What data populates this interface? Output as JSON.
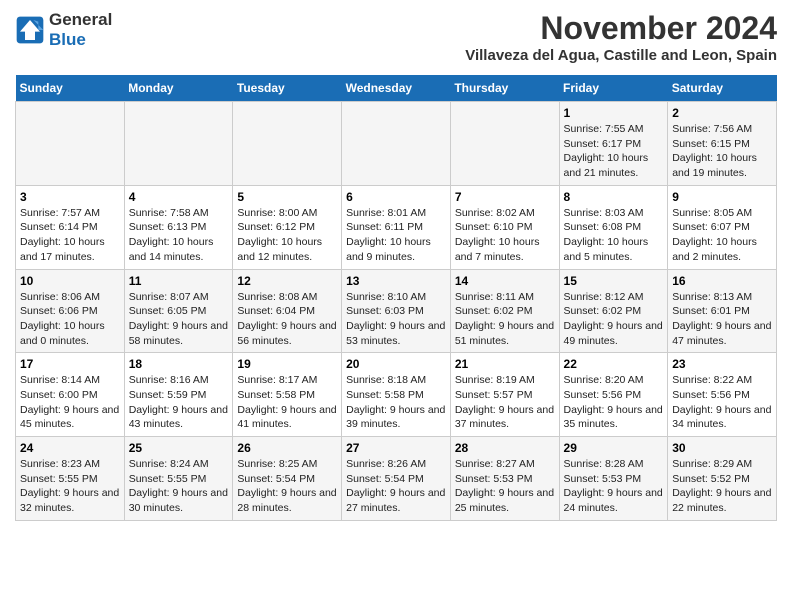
{
  "header": {
    "logo_line1": "General",
    "logo_line2": "Blue",
    "month": "November 2024",
    "location": "Villaveza del Agua, Castille and Leon, Spain"
  },
  "days_of_week": [
    "Sunday",
    "Monday",
    "Tuesday",
    "Wednesday",
    "Thursday",
    "Friday",
    "Saturday"
  ],
  "weeks": [
    [
      {
        "day": "",
        "info": ""
      },
      {
        "day": "",
        "info": ""
      },
      {
        "day": "",
        "info": ""
      },
      {
        "day": "",
        "info": ""
      },
      {
        "day": "",
        "info": ""
      },
      {
        "day": "1",
        "info": "Sunrise: 7:55 AM\nSunset: 6:17 PM\nDaylight: 10 hours and 21 minutes."
      },
      {
        "day": "2",
        "info": "Sunrise: 7:56 AM\nSunset: 6:15 PM\nDaylight: 10 hours and 19 minutes."
      }
    ],
    [
      {
        "day": "3",
        "info": "Sunrise: 7:57 AM\nSunset: 6:14 PM\nDaylight: 10 hours and 17 minutes."
      },
      {
        "day": "4",
        "info": "Sunrise: 7:58 AM\nSunset: 6:13 PM\nDaylight: 10 hours and 14 minutes."
      },
      {
        "day": "5",
        "info": "Sunrise: 8:00 AM\nSunset: 6:12 PM\nDaylight: 10 hours and 12 minutes."
      },
      {
        "day": "6",
        "info": "Sunrise: 8:01 AM\nSunset: 6:11 PM\nDaylight: 10 hours and 9 minutes."
      },
      {
        "day": "7",
        "info": "Sunrise: 8:02 AM\nSunset: 6:10 PM\nDaylight: 10 hours and 7 minutes."
      },
      {
        "day": "8",
        "info": "Sunrise: 8:03 AM\nSunset: 6:08 PM\nDaylight: 10 hours and 5 minutes."
      },
      {
        "day": "9",
        "info": "Sunrise: 8:05 AM\nSunset: 6:07 PM\nDaylight: 10 hours and 2 minutes."
      }
    ],
    [
      {
        "day": "10",
        "info": "Sunrise: 8:06 AM\nSunset: 6:06 PM\nDaylight: 10 hours and 0 minutes."
      },
      {
        "day": "11",
        "info": "Sunrise: 8:07 AM\nSunset: 6:05 PM\nDaylight: 9 hours and 58 minutes."
      },
      {
        "day": "12",
        "info": "Sunrise: 8:08 AM\nSunset: 6:04 PM\nDaylight: 9 hours and 56 minutes."
      },
      {
        "day": "13",
        "info": "Sunrise: 8:10 AM\nSunset: 6:03 PM\nDaylight: 9 hours and 53 minutes."
      },
      {
        "day": "14",
        "info": "Sunrise: 8:11 AM\nSunset: 6:02 PM\nDaylight: 9 hours and 51 minutes."
      },
      {
        "day": "15",
        "info": "Sunrise: 8:12 AM\nSunset: 6:02 PM\nDaylight: 9 hours and 49 minutes."
      },
      {
        "day": "16",
        "info": "Sunrise: 8:13 AM\nSunset: 6:01 PM\nDaylight: 9 hours and 47 minutes."
      }
    ],
    [
      {
        "day": "17",
        "info": "Sunrise: 8:14 AM\nSunset: 6:00 PM\nDaylight: 9 hours and 45 minutes."
      },
      {
        "day": "18",
        "info": "Sunrise: 8:16 AM\nSunset: 5:59 PM\nDaylight: 9 hours and 43 minutes."
      },
      {
        "day": "19",
        "info": "Sunrise: 8:17 AM\nSunset: 5:58 PM\nDaylight: 9 hours and 41 minutes."
      },
      {
        "day": "20",
        "info": "Sunrise: 8:18 AM\nSunset: 5:58 PM\nDaylight: 9 hours and 39 minutes."
      },
      {
        "day": "21",
        "info": "Sunrise: 8:19 AM\nSunset: 5:57 PM\nDaylight: 9 hours and 37 minutes."
      },
      {
        "day": "22",
        "info": "Sunrise: 8:20 AM\nSunset: 5:56 PM\nDaylight: 9 hours and 35 minutes."
      },
      {
        "day": "23",
        "info": "Sunrise: 8:22 AM\nSunset: 5:56 PM\nDaylight: 9 hours and 34 minutes."
      }
    ],
    [
      {
        "day": "24",
        "info": "Sunrise: 8:23 AM\nSunset: 5:55 PM\nDaylight: 9 hours and 32 minutes."
      },
      {
        "day": "25",
        "info": "Sunrise: 8:24 AM\nSunset: 5:55 PM\nDaylight: 9 hours and 30 minutes."
      },
      {
        "day": "26",
        "info": "Sunrise: 8:25 AM\nSunset: 5:54 PM\nDaylight: 9 hours and 28 minutes."
      },
      {
        "day": "27",
        "info": "Sunrise: 8:26 AM\nSunset: 5:54 PM\nDaylight: 9 hours and 27 minutes."
      },
      {
        "day": "28",
        "info": "Sunrise: 8:27 AM\nSunset: 5:53 PM\nDaylight: 9 hours and 25 minutes."
      },
      {
        "day": "29",
        "info": "Sunrise: 8:28 AM\nSunset: 5:53 PM\nDaylight: 9 hours and 24 minutes."
      },
      {
        "day": "30",
        "info": "Sunrise: 8:29 AM\nSunset: 5:52 PM\nDaylight: 9 hours and 22 minutes."
      }
    ]
  ]
}
